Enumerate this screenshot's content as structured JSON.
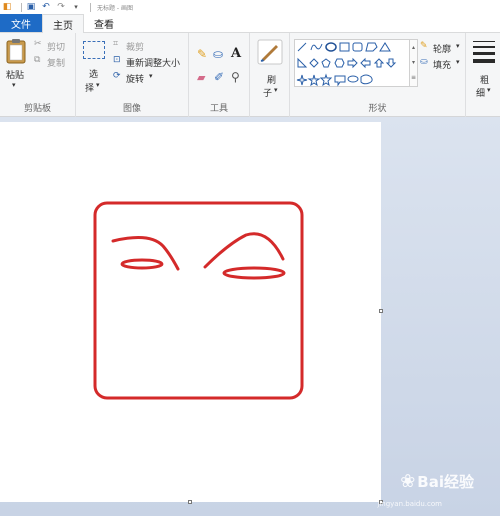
{
  "title_bar": {
    "title": "无标题 - 画图"
  },
  "tabs": {
    "file": "文件",
    "home": "主页",
    "view": "查看"
  },
  "clipboard": {
    "paste": "粘贴",
    "cut": "剪切",
    "copy": "复制",
    "group": "剪贴板"
  },
  "image": {
    "select_1": "选",
    "select_2": "择",
    "crop": "裁剪",
    "resize": "重新调整大小",
    "rotate": "旋转",
    "group": "图像"
  },
  "tools": {
    "text_tool": "A",
    "group": "工具"
  },
  "brushes": {
    "label_1": "刷",
    "label_2": "子"
  },
  "shapes": {
    "outline": "轮廓",
    "fill": "填充",
    "group": "形状"
  },
  "size": {
    "label_1": "粗",
    "label_2": "细"
  },
  "watermark": {
    "brand": "Bai经验",
    "sub": "jingyan.baidu.com"
  },
  "colors": {
    "drawing": "#d42a2a",
    "accent": "#1e6bc6"
  }
}
